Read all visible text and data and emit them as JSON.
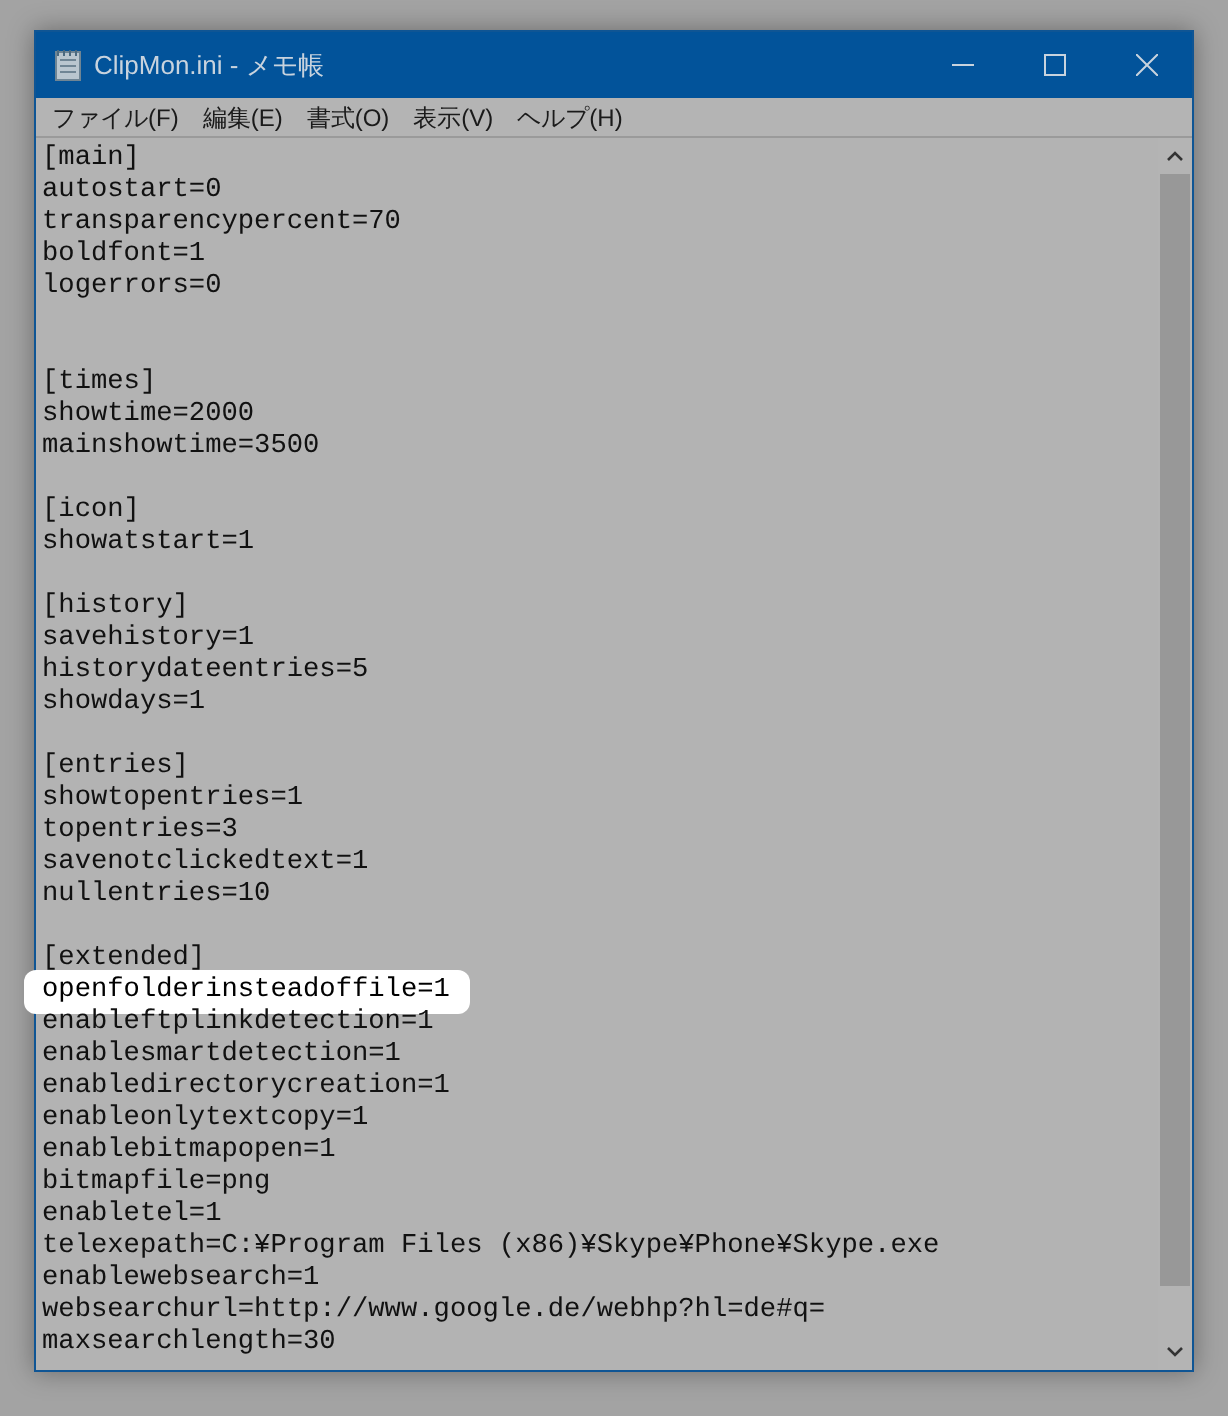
{
  "window": {
    "title": "ClipMon.ini - メモ帳"
  },
  "menu": [
    {
      "label": "ファイル(F)"
    },
    {
      "label": "編集(E)"
    },
    {
      "label": "書式(O)"
    },
    {
      "label": "表示(V)"
    },
    {
      "label": "ヘルプ(H)"
    }
  ],
  "lines": [
    {
      "kind": "line",
      "text": "[main]",
      "highlighted": false
    },
    {
      "kind": "line",
      "text": "autostart=0",
      "highlighted": false
    },
    {
      "kind": "line",
      "text": "transparencypercent=70",
      "highlighted": false
    },
    {
      "kind": "line",
      "text": "boldfont=1",
      "highlighted": false
    },
    {
      "kind": "line",
      "text": "logerrors=0",
      "highlighted": false
    },
    {
      "kind": "blank"
    },
    {
      "kind": "blank"
    },
    {
      "kind": "line",
      "text": "[times]",
      "highlighted": false
    },
    {
      "kind": "line",
      "text": "showtime=2000",
      "highlighted": false
    },
    {
      "kind": "line",
      "text": "mainshowtime=3500",
      "highlighted": false
    },
    {
      "kind": "blank"
    },
    {
      "kind": "line",
      "text": "[icon]",
      "highlighted": false
    },
    {
      "kind": "line",
      "text": "showatstart=1",
      "highlighted": false
    },
    {
      "kind": "blank"
    },
    {
      "kind": "line",
      "text": "[history]",
      "highlighted": false
    },
    {
      "kind": "line",
      "text": "savehistory=1",
      "highlighted": false
    },
    {
      "kind": "line",
      "text": "historydateentries=5",
      "highlighted": false
    },
    {
      "kind": "line",
      "text": "showdays=1",
      "highlighted": false
    },
    {
      "kind": "blank"
    },
    {
      "kind": "line",
      "text": "[entries]",
      "highlighted": false
    },
    {
      "kind": "line",
      "text": "showtopentries=1",
      "highlighted": false
    },
    {
      "kind": "line",
      "text": "topentries=3",
      "highlighted": false
    },
    {
      "kind": "line",
      "text": "savenotclickedtext=1",
      "highlighted": false
    },
    {
      "kind": "line",
      "text": "nullentries=10",
      "highlighted": false
    },
    {
      "kind": "blank"
    },
    {
      "kind": "line",
      "text": "[extended]",
      "highlighted": false
    },
    {
      "kind": "line",
      "text": "openfolderinsteadoffile=1",
      "highlighted": true
    },
    {
      "kind": "line",
      "text": "enableftplinkdetection=1",
      "highlighted": false
    },
    {
      "kind": "line",
      "text": "enablesmartdetection=1",
      "highlighted": false
    },
    {
      "kind": "line",
      "text": "enabledirectorycreation=1",
      "highlighted": false
    },
    {
      "kind": "line",
      "text": "enableonlytextcopy=1",
      "highlighted": false
    },
    {
      "kind": "line",
      "text": "enablebitmapopen=1",
      "highlighted": false
    },
    {
      "kind": "line",
      "text": "bitmapfile=png",
      "highlighted": false
    },
    {
      "kind": "line",
      "text": "enabletel=1",
      "highlighted": false
    },
    {
      "kind": "line",
      "text": "telexepath=C:¥Program Files (x86)¥Skype¥Phone¥Skype.exe",
      "highlighted": false
    },
    {
      "kind": "line",
      "text": "enablewebsearch=1",
      "highlighted": false
    },
    {
      "kind": "line",
      "text": "websearchurl=http://www.google.de/webhp?hl=de#q=",
      "highlighted": false
    },
    {
      "kind": "line",
      "text": "maxsearchlength=30",
      "highlighted": false
    }
  ]
}
